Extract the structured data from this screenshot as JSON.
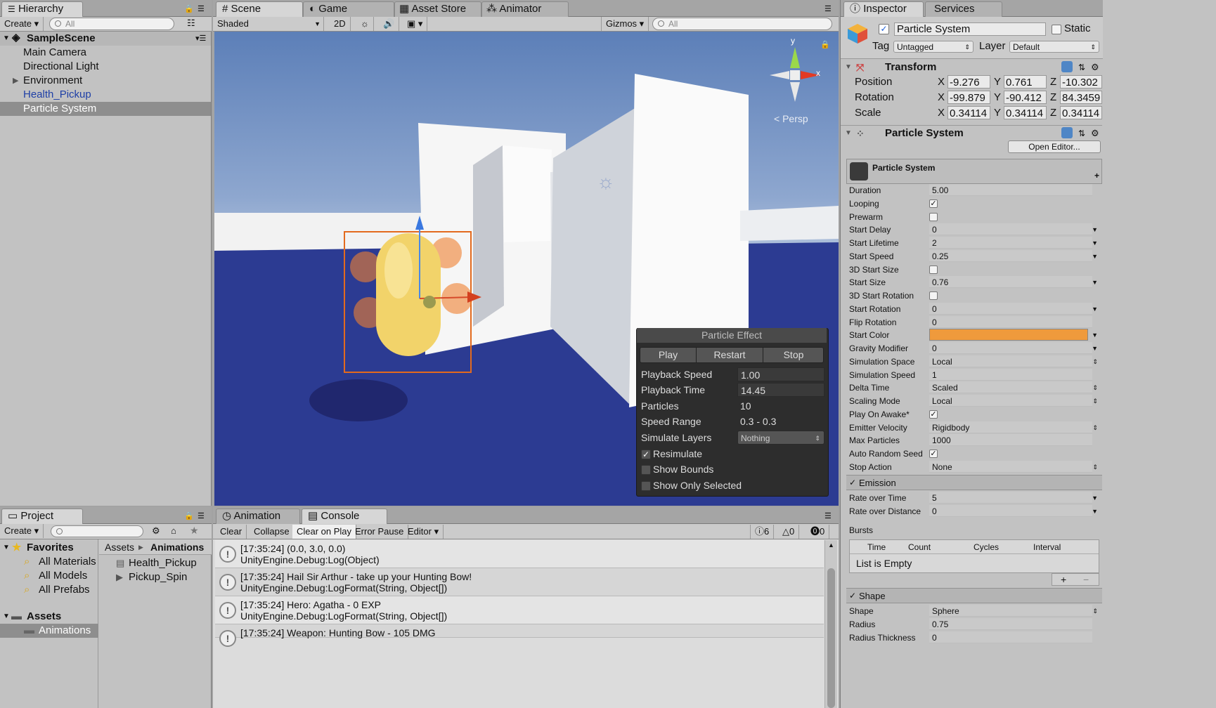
{
  "hierarchy": {
    "tab": "Hierarchy",
    "create": "Create",
    "search_placeholder": "All",
    "scene": "SampleScene",
    "items": [
      "Main Camera",
      "Directional Light",
      "Environment",
      "Health_Pickup",
      "Particle System"
    ]
  },
  "scene_tabs": [
    "Scene",
    "Game",
    "Asset Store",
    "Animator"
  ],
  "scene_toolbar": {
    "shading": "Shaded",
    "mode_2d": "2D",
    "gizmos": "Gizmos",
    "search_placeholder": "All"
  },
  "scene_view": {
    "persp": "Persp",
    "axis_y": "y",
    "axis_x": "x"
  },
  "particle_effect": {
    "title": "Particle Effect",
    "buttons": [
      "Play",
      "Restart",
      "Stop"
    ],
    "rows": [
      {
        "label": "Playback Speed",
        "value": "1.00"
      },
      {
        "label": "Playback Time",
        "value": "14.45"
      },
      {
        "label": "Particles",
        "value": "10"
      },
      {
        "label": "Speed Range",
        "value": "0.3 - 0.3"
      },
      {
        "label": "Simulate Layers",
        "value": "Nothing"
      }
    ],
    "toggles": [
      {
        "label": "Resimulate",
        "checked": true
      },
      {
        "label": "Show Bounds",
        "checked": false
      },
      {
        "label": "Show Only Selected",
        "checked": false
      }
    ]
  },
  "project": {
    "tab": "Project",
    "create": "Create",
    "favorites": "Favorites",
    "favorite_items": [
      "All Materials",
      "All Models",
      "All Prefabs"
    ],
    "assets": "Assets",
    "folders": [
      "Animations"
    ],
    "breadcrumb": [
      "Assets",
      "Animations"
    ],
    "files": [
      "Health_Pickup",
      "Pickup_Spin"
    ]
  },
  "console": {
    "tabs": [
      "Animation",
      "Console"
    ],
    "toolbar": [
      "Clear",
      "Collapse",
      "Clear on Play",
      "Error Pause",
      "Editor"
    ],
    "counts": {
      "info": "6",
      "warn": "0",
      "error": "0"
    },
    "logs": [
      {
        "line1": "[17:35:24] (0.0, 3.0, 0.0)",
        "line2": "UnityEngine.Debug:Log(Object)"
      },
      {
        "line1": "[17:35:24] Hail Sir Arthur - take up your Hunting Bow!",
        "line2": "UnityEngine.Debug:LogFormat(String, Object[])"
      },
      {
        "line1": "[17:35:24] Hero: Agatha - 0 EXP",
        "line2": "UnityEngine.Debug:LogFormat(String, Object[])"
      },
      {
        "line1": "[17:35:24] Weapon: Hunting Bow - 105 DMG",
        "line2": ""
      }
    ]
  },
  "inspector": {
    "tabs": [
      "Inspector",
      "Services"
    ],
    "object_name": "Particle System",
    "static": "Static",
    "tag_label": "Tag",
    "tag": "Untagged",
    "layer_label": "Layer",
    "layer": "Default",
    "transform": {
      "title": "Transform",
      "rows": [
        {
          "label": "Position",
          "x": "-9.276",
          "y": "0.761",
          "z": "-10.302"
        },
        {
          "label": "Rotation",
          "x": "-99.879",
          "y": "-90.412",
          "z": "84.3459"
        },
        {
          "label": "Scale",
          "x": "0.34114",
          "y": "0.34114",
          "z": "0.34114"
        }
      ]
    },
    "ps_component": "Particle System",
    "open_editor": "Open Editor...",
    "ps_module": "Particle System",
    "props": [
      {
        "label": "Duration",
        "value": "5.00",
        "kind": "text"
      },
      {
        "label": "Looping",
        "value": "",
        "kind": "check",
        "checked": true
      },
      {
        "label": "Prewarm",
        "value": "",
        "kind": "check",
        "checked": false
      },
      {
        "label": "Start Delay",
        "value": "0",
        "kind": "drop"
      },
      {
        "label": "Start Lifetime",
        "value": "2",
        "kind": "drop"
      },
      {
        "label": "Start Speed",
        "value": "0.25",
        "kind": "drop"
      },
      {
        "label": "3D Start Size",
        "value": "",
        "kind": "check",
        "checked": false
      },
      {
        "label": "Start Size",
        "value": "0.76",
        "kind": "drop"
      },
      {
        "label": "3D Start Rotation",
        "value": "",
        "kind": "check",
        "checked": false
      },
      {
        "label": "Start Rotation",
        "value": "0",
        "kind": "drop"
      },
      {
        "label": "Flip Rotation",
        "value": "0",
        "kind": "text"
      },
      {
        "label": "Start Color",
        "value": "",
        "kind": "color"
      },
      {
        "label": "Gravity Modifier",
        "value": "0",
        "kind": "drop"
      },
      {
        "label": "Simulation Space",
        "value": "Local",
        "kind": "select"
      },
      {
        "label": "Simulation Speed",
        "value": "1",
        "kind": "text"
      },
      {
        "label": "Delta Time",
        "value": "Scaled",
        "kind": "select"
      },
      {
        "label": "Scaling Mode",
        "value": "Local",
        "kind": "select"
      },
      {
        "label": "Play On Awake*",
        "value": "",
        "kind": "check",
        "checked": true
      },
      {
        "label": "Emitter Velocity",
        "value": "Rigidbody",
        "kind": "select"
      },
      {
        "label": "Max Particles",
        "value": "1000",
        "kind": "text"
      },
      {
        "label": "Auto Random Seed",
        "value": "",
        "kind": "check",
        "checked": true
      },
      {
        "label": "Stop Action",
        "value": "None",
        "kind": "select"
      }
    ],
    "emission": {
      "title": "Emission",
      "rows": [
        {
          "label": "Rate over Time",
          "value": "5"
        },
        {
          "label": "Rate over Distance",
          "value": "0"
        }
      ],
      "bursts": "Bursts",
      "burst_cols": [
        "Time",
        "Count",
        "Cycles",
        "Interval"
      ],
      "empty": "List is Empty"
    },
    "shape": {
      "title": "Shape",
      "rows": [
        {
          "label": "Shape",
          "value": "Sphere"
        },
        {
          "label": "Radius",
          "value": "0.75"
        },
        {
          "label": "Radius Thickness",
          "value": "0"
        }
      ]
    }
  },
  "colors": {
    "start_color": "#ef9a3c",
    "selection": "#8e8e8e",
    "link_blue": "#1e3fa6"
  }
}
